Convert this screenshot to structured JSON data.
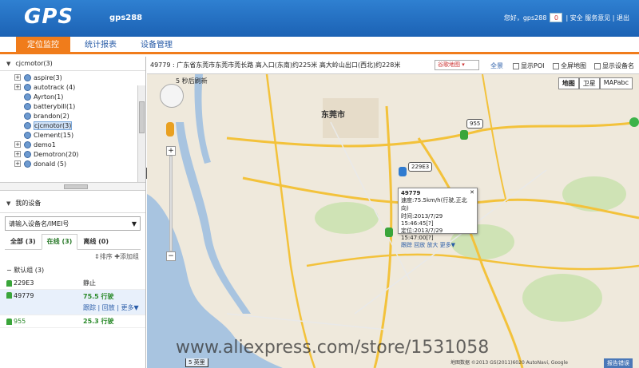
{
  "header": {
    "logo": "GPS",
    "account": "gps288",
    "greeting": "您好，gps288",
    "message_count": "0",
    "links": "| 安全 服务意见 | 退出"
  },
  "tabs": [
    {
      "label": "定位监控"
    },
    {
      "label": "统计报表"
    },
    {
      "label": "设备管理"
    }
  ],
  "tree": {
    "root": "cjcmotor(3)",
    "items": [
      {
        "label": "aspire(3)"
      },
      {
        "label": "autotrack (4)"
      },
      {
        "label": "Ayrton(1)"
      },
      {
        "label": "batterybill(1)"
      },
      {
        "label": "brandon(2)"
      },
      {
        "label": "cjcmotor(3)"
      },
      {
        "label": "Clement(15)"
      },
      {
        "label": "demo1"
      },
      {
        "label": "Demotron(20)"
      },
      {
        "label": "donald (5)"
      }
    ]
  },
  "devices": {
    "header": "我的设备",
    "search_placeholder": "请输入设备名/IMEI号",
    "filter_tabs": [
      {
        "label": "全部 (3)"
      },
      {
        "label": "在线 (3)"
      },
      {
        "label": "离线 (0)"
      }
    ],
    "sort_label": "排序",
    "add_group_label": "添加组",
    "group_label": "默认组",
    "group_count": "(3)",
    "rows": [
      {
        "name": "229E3",
        "status": "静止"
      },
      {
        "name": "49779",
        "status": "75.5 行驶",
        "actions": "跟踪 | 回放 | 更多▼"
      },
      {
        "name": "955",
        "status": "25.3 行驶"
      }
    ]
  },
  "map": {
    "address": "49779 : 广东省东莞市东莞市莞长路 高入口(东南)约225米 高大岭山出口(西北)约228米",
    "map_select": "谷歌地图",
    "all_link": "全景",
    "checkboxes": [
      {
        "label": "显示POI"
      },
      {
        "label": "全屏地图"
      },
      {
        "label": "显示设备名"
      }
    ],
    "type_buttons": [
      {
        "label": "地图"
      },
      {
        "label": "卫星"
      },
      {
        "label": "MAPabc"
      }
    ],
    "countdown": "5 秒后刷新",
    "vehicles": [
      {
        "label": "955"
      },
      {
        "label": "229E3"
      }
    ],
    "popup": {
      "id": "49779",
      "speed": "速度:75.5km/h(行驶,正北向)",
      "time": "时间:2013/7/29 15:46:45[?]",
      "located": "定位:2013/7/29 15:47:00[?]",
      "links": "跟踪 回放 放大 更多▼"
    },
    "city_label": "东莞市",
    "scale": "5 英里",
    "copyright": "地图数据 ©2013 GS(2011)6020 AutoNavi, Google",
    "report": "报告错误",
    "watermark": "www.aliexpress.com/store/1531058"
  },
  "colors": {
    "header_blue": "#2170c4",
    "tab_orange": "#f07c1b",
    "moving_green": "#2a8a2a"
  }
}
